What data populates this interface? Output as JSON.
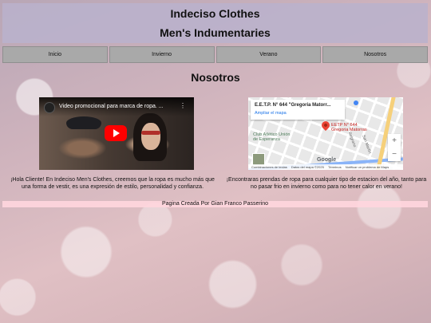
{
  "header": {
    "title": "Indeciso Clothes",
    "subtitle": "Men's Indumentaries"
  },
  "nav": {
    "items": [
      {
        "label": "Inicio"
      },
      {
        "label": "Invierno"
      },
      {
        "label": "Verano"
      },
      {
        "label": "Nosotros"
      }
    ]
  },
  "section_title": "Nosotros",
  "video": {
    "title": "Video promocional para marca de ropa. ...",
    "more_icon": "⋮"
  },
  "map": {
    "place_name": "E.E.T.P. N° 644 \"Gregoria Matorr...",
    "link": "Ampliar el mapa",
    "pin_label_line1": "EETP N° 644",
    "pin_label_line2": "Gregoria Matorras",
    "park_line1": "Club Atlético Unión",
    "park_line2": "de Esperanza",
    "street1": "Belgrano",
    "street2": "San Martín",
    "zoom_in": "+",
    "zoom_out": "−",
    "brand": "Google",
    "footer": [
      "Combinaciones de teclas",
      "Datos del mapa ©2025",
      "Términos",
      "Notificar un problema de Maps"
    ]
  },
  "content": {
    "left_text": "¡Hola Cliente! En Indeciso Men's Clothes, creemos que la ropa es mucho más que una forma de vestir, es una expresión de estilo, personalidad y confianza.",
    "right_text": "¡Encontraras prendas de ropa para cualquier tipo de estacion del año, tanto para no pasar frio en invierno como para no tener calor en verano!"
  },
  "footer": {
    "credit": "Pagina Creada Por Gian Franco Passerino"
  }
}
